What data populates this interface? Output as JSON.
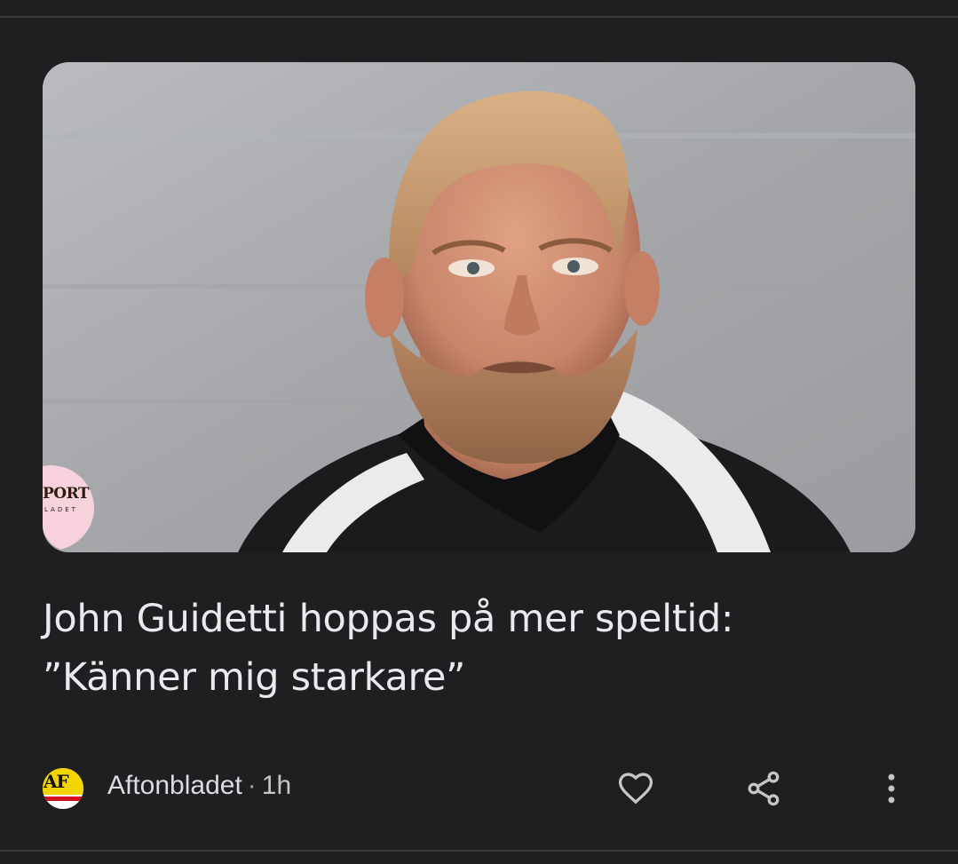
{
  "article": {
    "image_alt": "Man with reddish-blond hair and beard in a black and white training top",
    "image_badge": {
      "text": "PORT",
      "subtext": "LADET"
    },
    "headline": "John Guidetti hoppas på mer speltid: ”Känner mig starkare”",
    "source": {
      "logo_text": "AF",
      "name": "Aftonbladet",
      "separator": "·",
      "age": "1h"
    },
    "actions": {
      "like_icon": "heart-outline-icon",
      "share_icon": "share-icon",
      "more_icon": "more-vertical-icon"
    }
  },
  "colors": {
    "background": "#1f1f21",
    "text": "#e8eaed",
    "icon": "#c4c7c5"
  }
}
